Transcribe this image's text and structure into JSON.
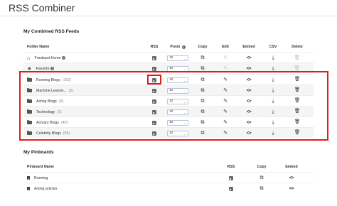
{
  "app": {
    "title": "RSS Combiner"
  },
  "combined": {
    "section_title": "My Combined RSS Feeds",
    "headers": {
      "folder_name": "Folder Name",
      "rss": "RSS",
      "posts": "Posts",
      "copy": "Copy",
      "edit": "Edit",
      "embed": "Embed",
      "csv": "CSV",
      "delete": "Delete"
    },
    "rows": [
      {
        "name": "Feedspot Home",
        "count": "",
        "posts": "10"
      },
      {
        "name": "Favorite",
        "count": "",
        "posts": "10"
      },
      {
        "name": "Running Blogs",
        "count": "(152)",
        "posts": "10"
      },
      {
        "name": "Machine Learnin...",
        "count": "(2)",
        "posts": "10"
      },
      {
        "name": "Acting Blogs",
        "count": "(3)",
        "posts": "10"
      },
      {
        "name": "Technology",
        "count": "(1)",
        "posts": "10"
      },
      {
        "name": "Actuary Blogs",
        "count": "(40)",
        "posts": "10"
      },
      {
        "name": "Celebrity Blogs",
        "count": "(85)",
        "posts": "10"
      }
    ]
  },
  "pinboards": {
    "section_title": "My Pinboards",
    "headers": {
      "pinboard_name": "Pinboard Name",
      "rss": "RSS",
      "copy": "Copy",
      "embed": "Embed"
    },
    "rows": [
      {
        "name": "Running"
      },
      {
        "name": "Acting articles"
      }
    ]
  },
  "icons": {
    "info": "i",
    "embed": "<>",
    "chevron": "⌵"
  },
  "colors": {
    "highlight": "#e01b1b",
    "select_border": "#b9c6d6"
  }
}
